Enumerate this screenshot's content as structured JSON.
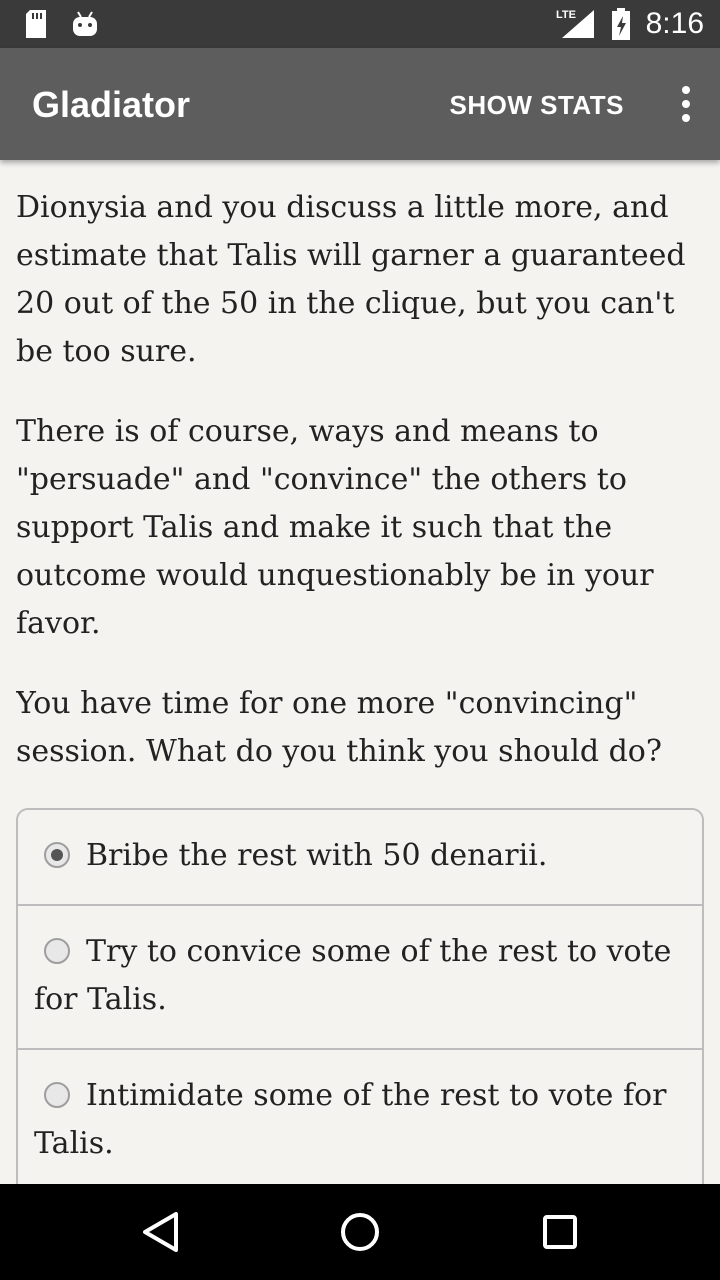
{
  "status_bar": {
    "network": "LTE",
    "time": "8:16"
  },
  "app_bar": {
    "title": "Gladiator",
    "show_stats_label": "SHOW STATS",
    "overflow_icon": "more-vert-icon"
  },
  "story": {
    "paragraphs": [
      "Dionysia and you discuss a little more, and estimate that Talis will garner a guaranteed 20 out of the 50 in the clique, but you can't be too sure.",
      "There is of course, ways and means to \"persuade\" and \"convince\" the others to support Talis and make it such that the outcome would unquestionably be in your favor.",
      "You have time for one more \"convincing\" session. What do you think you should do?"
    ]
  },
  "choices": [
    {
      "label": "Bribe the rest with 50 denarii.",
      "selected": true
    },
    {
      "label": "Try to convice some of the rest to vote for Talis.",
      "selected": false
    },
    {
      "label": "Intimidate some of the rest to vote for Talis.",
      "selected": false
    }
  ],
  "nav_bar": {
    "back_icon": "back-triangle-icon",
    "home_icon": "home-circle-icon",
    "recents_icon": "recents-square-icon"
  }
}
